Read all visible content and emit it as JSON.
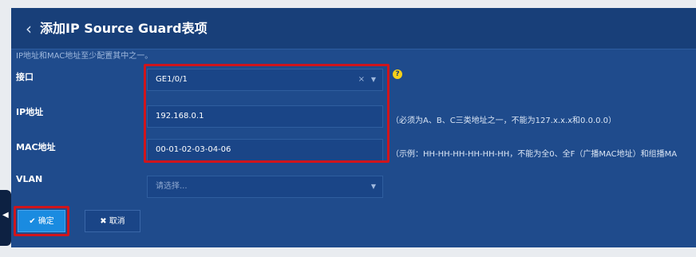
{
  "header": {
    "back_icon": "chevron-left-icon",
    "title": "添加IP Source Guard表项"
  },
  "form": {
    "hint": "IP地址和MAC地址至少配置其中之一。",
    "interface": {
      "label": "接口",
      "value": "GE1/0/1",
      "clear": "×",
      "arrow": "▼",
      "help": "?"
    },
    "ip": {
      "label": "IP地址",
      "value": "192.168.0.1",
      "note": "（必须为A、B、C三类地址之一，不能为127.x.x.x和0.0.0.0）"
    },
    "mac": {
      "label": "MAC地址",
      "value": "00-01-02-03-04-06",
      "note": "（示例：HH-HH-HH-HH-HH-HH，不能为全0、全F（广播MAC地址）和组播MA"
    },
    "vlan": {
      "label": "VLAN",
      "placeholder": "请选择...",
      "arrow": "▼"
    }
  },
  "buttons": {
    "ok": {
      "icon": "✔",
      "label": "确定"
    },
    "cancel": {
      "icon": "✖",
      "label": "取消"
    }
  },
  "side_tab": {
    "icon": "◀"
  },
  "colors": {
    "panel": "#1f4b8c",
    "header": "#183f79",
    "accent": "#1a8be0",
    "highlight": "#d0151c",
    "help": "#f5d018"
  }
}
